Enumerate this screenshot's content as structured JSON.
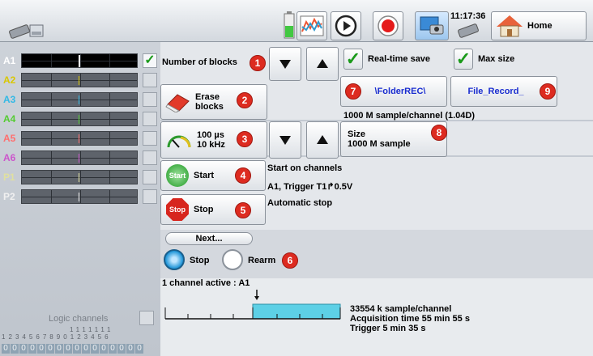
{
  "header": {
    "time": "11:17:36",
    "home_label": "Home"
  },
  "channels": [
    {
      "name": "A1",
      "color": "#ffffff",
      "checked": true
    },
    {
      "name": "A2",
      "color": "#d9c700",
      "checked": false
    },
    {
      "name": "A3",
      "color": "#33b9e5",
      "checked": false
    },
    {
      "name": "A4",
      "color": "#55cc33",
      "checked": false
    },
    {
      "name": "A5",
      "color": "#ff6f6f",
      "checked": false
    },
    {
      "name": "A6",
      "color": "#cc55cc",
      "checked": false
    },
    {
      "name": "P1",
      "color": "#e0e0a0",
      "checked": false
    },
    {
      "name": "P2",
      "color": "#f0f0f0",
      "checked": false
    }
  ],
  "logic": {
    "label": "Logic channels",
    "tens_row": "1 1 1 1 1 1 1",
    "units_row": "1 2 3 4 5 6 7 8 9 0 1 2 3 4 5 6",
    "digits": [
      "0",
      "0",
      "0",
      "0",
      "0",
      "0",
      "0",
      "0",
      "0",
      "0",
      "0",
      "0",
      "0",
      "0",
      "0",
      "0"
    ]
  },
  "controls": {
    "number_of_blocks": "Number of blocks",
    "erase_blocks": "Erase\nblocks",
    "period": "100 µs",
    "frequency": "10 kHz",
    "start": "Start",
    "stop": "Stop",
    "start_icon_text": "Start",
    "stop_icon_text": "Stop",
    "realtime_save": "Real-time save",
    "max_size": "Max size",
    "folder": "\\FolderREC\\",
    "file": "File_Record_",
    "sample_info": "1000 M sample/channel (1.04D)",
    "size_label": "Size",
    "size_value": "1000  M sample",
    "start_on_channels": "Start on channels",
    "trigger_desc": "A1, Trigger T1↱0.5V",
    "automatic_stop": "Automatic stop",
    "next": "Next...",
    "radio_stop": "Stop",
    "radio_rearm": "Rearm"
  },
  "badges": [
    "1",
    "2",
    "3",
    "4",
    "5",
    "6",
    "7",
    "8",
    "9"
  ],
  "status": {
    "active": "1 channel active : A1",
    "samples": "33554 k sample/channel",
    "acq_time": "Acquisition time 55 min 55 s",
    "trigger": "Trigger  5 min 35 s"
  }
}
